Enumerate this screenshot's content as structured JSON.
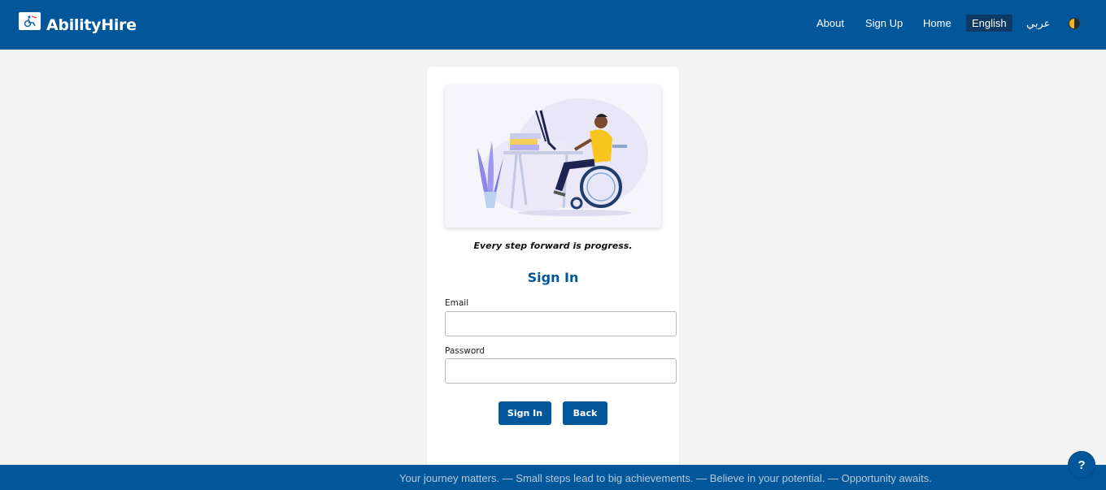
{
  "brand": {
    "name": "AbilityHire",
    "logo_icon": "wheelchair-logo-icon"
  },
  "nav": {
    "about": "About",
    "signup": "Sign Up",
    "home": "Home",
    "english": "English",
    "arabic": "عربي",
    "theme_icon": "half-moon-theme-icon"
  },
  "hero": {
    "illustration": "person-in-wheelchair-at-desk"
  },
  "tagline": "Every step forward is progress.",
  "form": {
    "title": "Sign In",
    "email_label": "Email",
    "email_value": "",
    "password_label": "Password",
    "password_value": "",
    "signin_button": "Sign In",
    "back_button": "Back"
  },
  "footer": {
    "ticker": "Your journey matters. — Small steps lead to big achievements. — Believe in your potential. — Opportunity awaits."
  },
  "help": {
    "label": "?"
  },
  "colors": {
    "primary": "#02579a",
    "background": "#f4f4f4",
    "active_lang_bg": "#0e3b66"
  }
}
